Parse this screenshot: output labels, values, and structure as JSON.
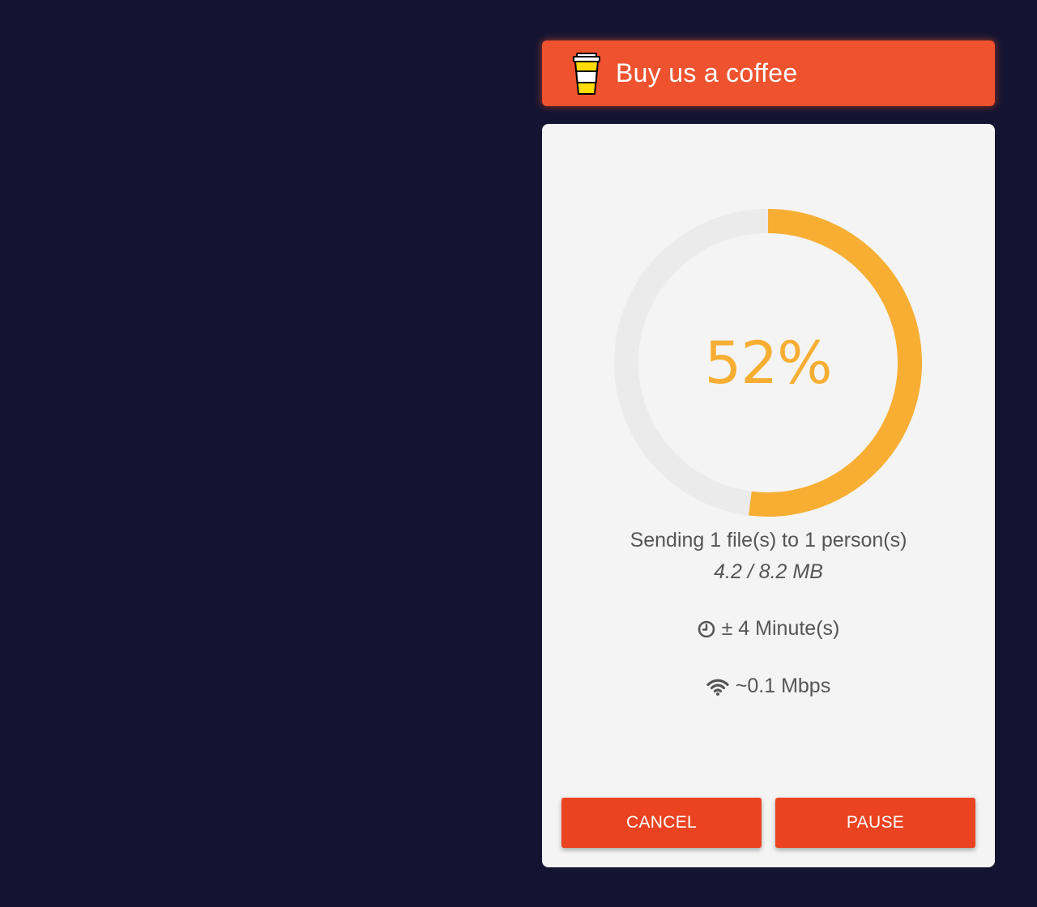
{
  "banner": {
    "label": "Buy us a coffee",
    "icon": "coffee-cup-icon"
  },
  "transfer": {
    "progress_percent": 52,
    "progress_label": "52%",
    "status": "Sending 1 file(s) to 1 person(s)",
    "size": "4.2 / 8.2 MB",
    "eta": "± 4 Minute(s)",
    "eta_icon": "clock-icon",
    "speed": "~0.1 Mbps",
    "speed_icon": "wifi-icon"
  },
  "actions": {
    "cancel_label": "CANCEL",
    "pause_label": "PAUSE"
  },
  "colors": {
    "background": "#141432",
    "banner": "#ee522e",
    "progress": "#f7ae33",
    "track": "#ebebeb",
    "button": "#ea4321"
  }
}
